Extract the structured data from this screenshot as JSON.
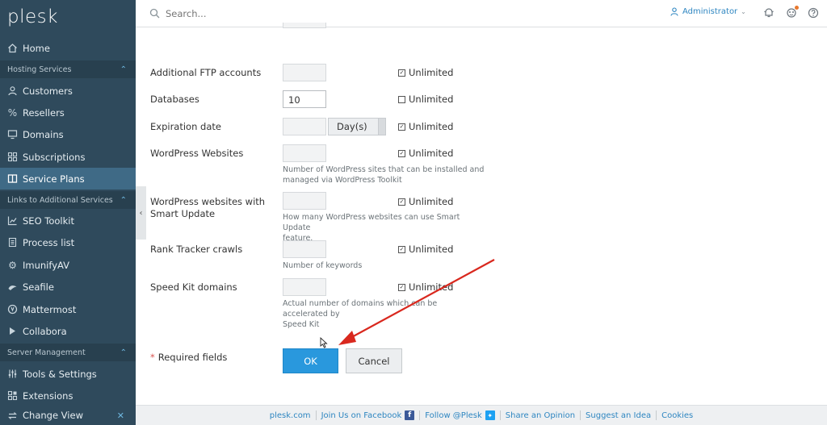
{
  "app": {
    "logo": "plesk"
  },
  "sidebar": {
    "home": "Home",
    "sections": [
      {
        "title": "Hosting Services",
        "items": [
          "Customers",
          "Resellers",
          "Domains",
          "Subscriptions",
          "Service Plans"
        ]
      },
      {
        "title": "Links to Additional Services",
        "items": [
          "SEO Toolkit",
          "Process list",
          "ImunifyAV",
          "Seafile",
          "Mattermost",
          "Collabora"
        ]
      },
      {
        "title": "Server Management",
        "items": [
          "Tools & Settings",
          "Extensions",
          "Change View"
        ]
      }
    ],
    "active_item": "Service Plans"
  },
  "topbar": {
    "search_placeholder": "Search...",
    "user": "Administrator"
  },
  "form": {
    "rows": [
      {
        "label": "Additional FTP accounts",
        "value": "",
        "unlimited_label": "Unlimited",
        "unlimited_checked": true
      },
      {
        "label": "Databases",
        "value": "10",
        "unlimited_label": "Unlimited",
        "unlimited_checked": false
      },
      {
        "label": "Expiration date",
        "value": "",
        "unit": "Day(s)",
        "unlimited_label": "Unlimited",
        "unlimited_checked": true
      },
      {
        "label": "WordPress Websites",
        "value": "",
        "unlimited_label": "Unlimited",
        "unlimited_checked": true,
        "hint_1": "Number of WordPress sites that can be installed and",
        "hint_2": "managed via WordPress Toolkit"
      },
      {
        "label_1": "WordPress websites with",
        "label_2": "Smart Update",
        "value": "",
        "unlimited_label": "Unlimited",
        "unlimited_checked": true,
        "hint_1": "How many WordPress websites can use Smart Update",
        "hint_2": "feature."
      },
      {
        "label": "Rank Tracker crawls",
        "value": "",
        "unlimited_label": "Unlimited",
        "unlimited_checked": true,
        "hint_1": "Number of keywords"
      },
      {
        "label": "Speed Kit domains",
        "value": "",
        "unlimited_label": "Unlimited",
        "unlimited_checked": true,
        "hint_1": "Actual number of domains which can be accelerated by",
        "hint_2": "Speed Kit"
      }
    ],
    "required_star": "*",
    "required_text": "Required fields",
    "ok_label": "OK",
    "cancel_label": "Cancel"
  },
  "footer": {
    "links": [
      "plesk.com",
      "Join Us on Facebook",
      "Follow @Plesk",
      "Share an Opinion",
      "Suggest an Idea",
      "Cookies"
    ]
  },
  "colors": {
    "sidebar_bg": "#2f4a5c",
    "sidebar_active": "#3f6a86",
    "accent": "#2998dd",
    "annotation_arrow": "#d9281e"
  }
}
